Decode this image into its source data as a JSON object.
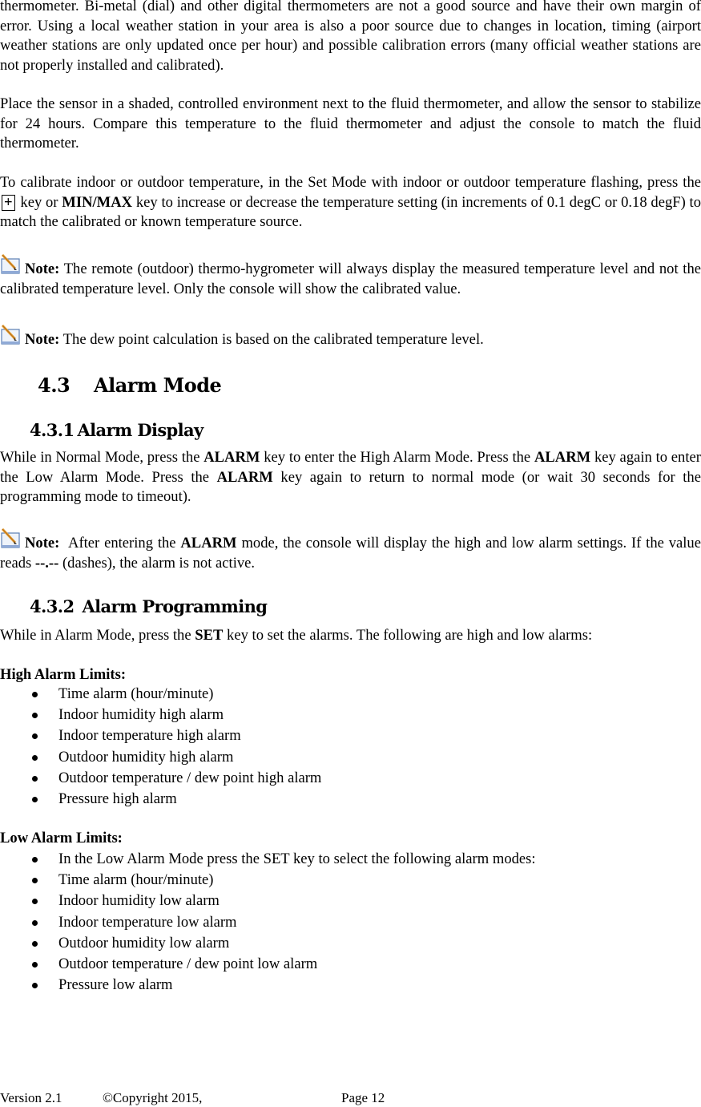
{
  "paragraphs": {
    "p1": "thermometer. Bi-metal (dial) and other digital thermometers are not a good source and have their own margin of error. Using a local weather station in your area is also a poor source due to changes in location, timing (airport weather stations are only updated once per hour) and possible calibration errors (many official weather stations are not properly installed and calibrated).",
    "p2": "Place the sensor in a shaded, controlled environment next to the fluid thermometer, and allow the sensor to stabilize for 24 hours. Compare this temperature to the fluid thermometer and adjust the console to match the fluid thermometer.",
    "p3_a": "To calibrate indoor or outdoor temperature, in the Set Mode with indoor or outdoor temperature flashing, press the",
    "p3_key1": "+",
    "p3_b": "key or",
    "p3_key2": "MIN/MAX",
    "p3_c": "key to increase or decrease the temperature setting (in increments of 0.1 degC or 0.18 degF) to match the calibrated or known temperature source."
  },
  "notes": {
    "label": "Note:",
    "note1": "The remote (outdoor) thermo-hygrometer will always display the measured temperature level and not the calibrated temperature level. Only the console will show the calibrated value.",
    "note2": "The dew point calculation is based on the calibrated temperature level.",
    "note3_a": "After entering the",
    "note3_key": "ALARM",
    "note3_b": "mode, the console will display the high and low alarm settings. If the value reads",
    "note3_dashes": "--.--",
    "note3_c": "(dashes), the alarm is not active."
  },
  "section": {
    "number": "4.3",
    "title": "Alarm Mode",
    "sub1_number": "4.3.1",
    "sub1_title": "Alarm Display",
    "sub2_number": "4.3.2",
    "sub2_title": "Alarm Programming"
  },
  "alarm_display": {
    "a": "While in Normal Mode, press the",
    "key": "ALARM",
    "b": "key to enter the High Alarm Mode.   Press the",
    "c": "key again to enter the Low Alarm Mode. Press the",
    "d": "key again to return to normal mode (or wait 30 seconds for the programming mode to timeout)."
  },
  "alarm_programming": {
    "a": "While in Alarm Mode, press the",
    "key": "SET",
    "b": "key to set the alarms. The following are high and low alarms:"
  },
  "high_limits": {
    "label": "High Alarm Limits:",
    "items": [
      "Time alarm (hour/minute)",
      "Indoor humidity high alarm",
      "Indoor temperature high alarm",
      "Outdoor humidity high alarm",
      "Outdoor temperature / dew point high alarm",
      "Pressure high alarm"
    ]
  },
  "low_limits": {
    "label": "Low Alarm Limits:",
    "items": [
      "In the Low Alarm Mode press the SET key to select the following alarm modes:",
      "Time alarm (hour/minute)",
      "Indoor humidity low alarm",
      "Indoor temperature low alarm",
      "Outdoor humidity low alarm",
      "Outdoor temperature / dew point low alarm",
      "Pressure low alarm"
    ]
  },
  "footer": {
    "version": "Version 2.1",
    "copyright": "©Copyright 2015,",
    "page": "Page 12"
  }
}
